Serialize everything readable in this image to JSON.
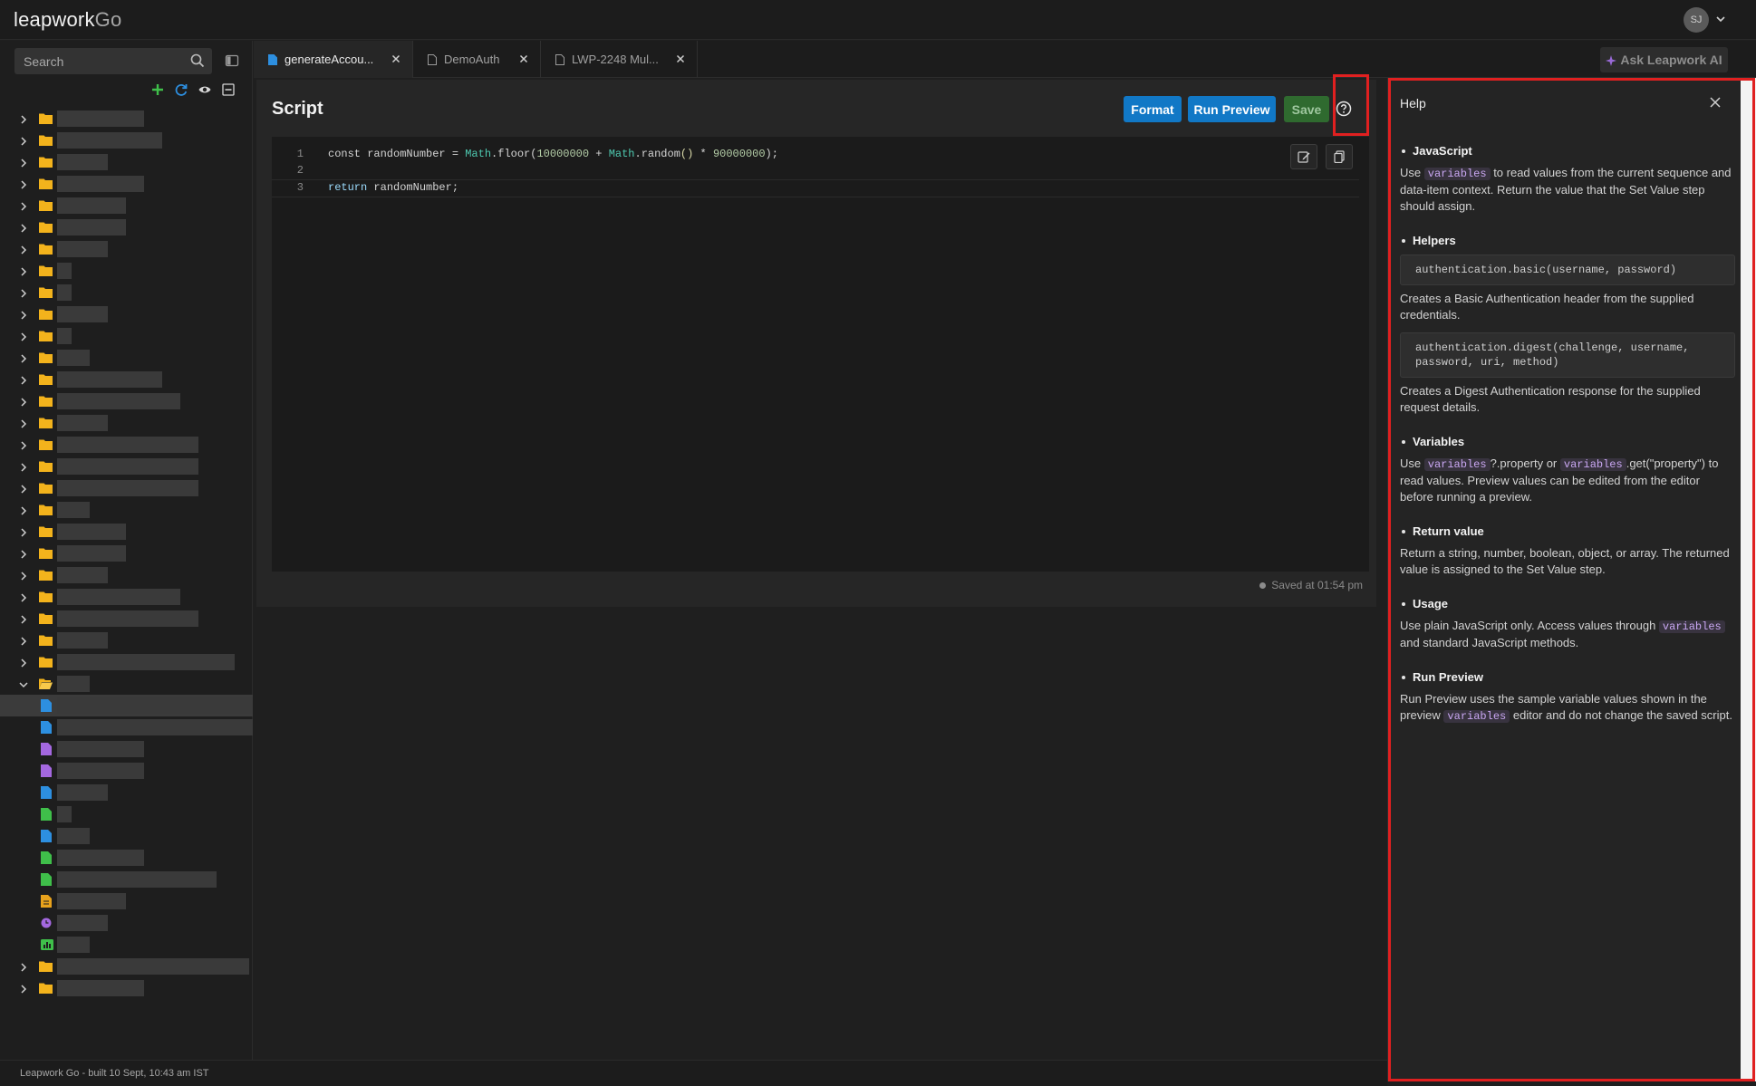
{
  "app": {
    "logo_main": "leapwork",
    "logo_go": "Go",
    "avatar_initials": "SJ"
  },
  "sidebar": {
    "search_placeholder": "Search"
  },
  "tabs": [
    {
      "label": "generateAccou...",
      "active": true
    },
    {
      "label": "DemoAuth",
      "active": false
    },
    {
      "label": "LWP-2248 Mul...",
      "active": false
    }
  ],
  "ask_ai": {
    "label": "Ask Leapwork AI"
  },
  "script": {
    "title": "Script",
    "format_label": "Format",
    "run_preview_label": "Run Preview",
    "save_label": "Save",
    "line_numbers": [
      "1",
      "2",
      "3"
    ],
    "saved_status": "Saved at 01:54 pm"
  },
  "help": {
    "title": "Help",
    "js_heading": "JavaScript",
    "js_text_1": "Use",
    "js_chip": "variables",
    "js_text_2": "to read values from the current sequence and data-item context. Return the value that the Set Value step should assign.",
    "helpers_heading": "Helpers",
    "basic_code": "authentication.basic(username, password)",
    "basic_desc": "Creates a Basic Authentication header from the supplied credentials.",
    "digest_code": "authentication.digest(challenge, username, password, uri, method)",
    "digest_desc": "Creates a Digest Authentication response for the supplied request details.",
    "variables_heading": "Variables",
    "var_text_1": "Use",
    "var_chip_1": "variables",
    "var_text_2": "?.property or",
    "var_chip_2": "variables",
    "var_text_3": ".get(\"property\") to read values. Preview values can be edited from the editor before running a preview.",
    "return_heading": "Return value",
    "return_text": "Return a string, number, boolean, object, or array. The returned value is assigned to the Set Value step.",
    "usage_heading": "Usage",
    "usage_text_1": "Use plain JavaScript only. Access values through",
    "usage_chip": "variables",
    "usage_text_2": "and standard JavaScript methods.",
    "run_heading": "Run Preview",
    "run_text_1": "Run Preview uses the sample variable values shown in the preview",
    "run_chip": "variables",
    "run_text_2": "editor and do not change the saved script."
  },
  "footer": {
    "build_text": "Leapwork Go - built 10 Sept, 10:43 am IST"
  },
  "colors": {
    "accent_blue": "#1178c6",
    "save_green": "#2f6a2f",
    "highlight_red": "#e02020",
    "folder_yellow": "#f3b31c"
  }
}
